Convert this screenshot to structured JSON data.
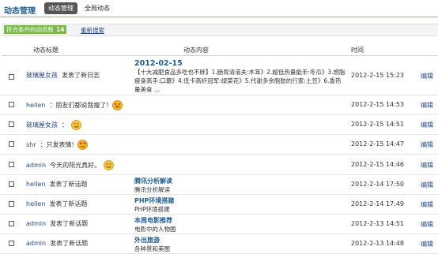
{
  "header": {
    "title": "动态管理",
    "tabs": [
      "动态管理",
      "全局动态"
    ]
  },
  "filter": {
    "label": "符合条件的动态数",
    "count": "14",
    "reset": "重新搜索"
  },
  "table": {
    "columns": [
      "动态标题",
      "动态内容",
      "时间"
    ],
    "edit_label": "编辑",
    "rows": [
      {
        "user": "玻璃屋女孩",
        "action": "发表了新日志",
        "emoji": "",
        "content_title": "2012-02-15",
        "content_text": "【十大减肥食品多吃也不胖】1.肠胃清道夫:木耳》2.超低热量能手:冬瓜》3.燃脂瘦身高手:口蘑》4.低卡高纤冠军:绿菜花》5.代谢多余脂肪的行家:土豆》6.香热量美食 ...",
        "time": "2012-2-15 15:23"
      },
      {
        "user": "hellen",
        "action": "：朋友们都说我瘦了!",
        "emoji": "happy",
        "content_title": "",
        "content_text": "",
        "time": "2012-2-15 14:53"
      },
      {
        "user": "玻璃屋女孩",
        "action": "：",
        "emoji": "smile",
        "content_title": "",
        "content_text": "",
        "time": "2012-2-15 14:51"
      },
      {
        "user": "shr",
        "action": "：只发表情!",
        "emoji": "love",
        "content_title": "",
        "content_text": "",
        "time": "2012-2-15 14:47"
      },
      {
        "user": "admin",
        "action": "今天的阳光真好。",
        "emoji": "smile",
        "content_title": "",
        "content_text": "",
        "time": "2012-2-15 14:46"
      },
      {
        "user": "hellen",
        "action": "发表了新话题",
        "emoji": "",
        "content_title": "腾讯分析解读",
        "content_text": "腾讯分析解读",
        "time": "2012-2-14 17:50"
      },
      {
        "user": "hellen",
        "action": "发表了新话题",
        "emoji": "",
        "content_title": "PHP环境搭建",
        "content_text": "PHP环境搭建",
        "time": "2012-2-14 17:49"
      },
      {
        "user": "admin",
        "action": "发表了新话题",
        "emoji": "",
        "content_title": "本周电影推荐",
        "content_text": "电影中的人物图",
        "time": "2012-2-13 14:51"
      },
      {
        "user": "admin",
        "action": "发表了新话题",
        "emoji": "",
        "content_title": "外出旅游",
        "content_text": "各种景和美图",
        "time": "2012-2-13 14:48"
      }
    ]
  },
  "colors": {
    "accent": "#1f5d92",
    "link": "#244b85",
    "badge": "#78b94a",
    "tab_active": "#555555",
    "emoji": "#f2b51f"
  }
}
